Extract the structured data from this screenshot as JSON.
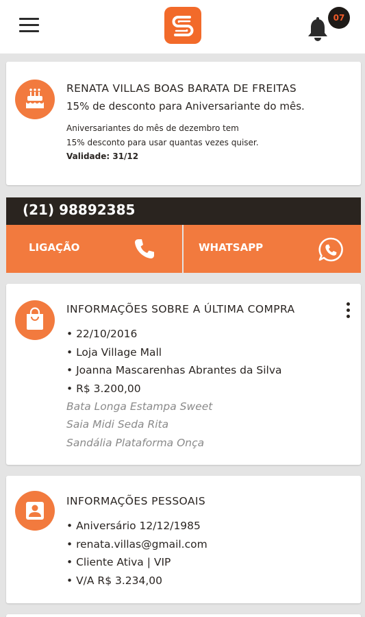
{
  "header": {
    "menu_icon": "hamburger-menu-icon",
    "logo_icon": "s-logo-icon",
    "bell_icon": "bell-icon",
    "notification_count": "07",
    "accent_color": "#f27a3e"
  },
  "birthday_card": {
    "icon": "birthday-cake-icon",
    "customer_name": "RENATA VILLAS BOAS BARATA DE FREITAS",
    "offer": "15% de desconto para Aniversariante do mês.",
    "details_line1": "Aniversariantes do mês de dezembro tem",
    "details_line2": "15% desconto para usar quantas vezes quiser.",
    "validity": "Validade: 31/12"
  },
  "contact": {
    "phone": "(21) 98892385",
    "call_label": "LIGAÇÃO",
    "call_icon": "phone-icon",
    "whatsapp_label": "WHATSAPP",
    "whatsapp_icon": "whatsapp-icon"
  },
  "last_purchase": {
    "icon": "shopping-bag-icon",
    "title": "INFORMAÇÕES SOBRE A ÚLTIMA COMPRA",
    "more_icon": "more-vertical-icon",
    "date": "• 22/10/2016",
    "store": "• Loja Village Mall",
    "seller": "• Joanna Mascarenhas Abrantes da Silva",
    "total": "• R$ 3.200,00",
    "products": [
      "Bata Longa Estampa Sweet",
      "Saia Midi Seda Rita",
      "Sandália Plataforma Onça"
    ]
  },
  "personal_info": {
    "icon": "person-icon",
    "title": "INFORMAÇÕES PESSOAIS",
    "birthday": "• Aniversário 12/12/1985",
    "email": "• renata.villas@gmail.com",
    "status": "• Cliente Ativa | VIP",
    "lifetime_value": "• V/A R$ 3.234,00"
  }
}
